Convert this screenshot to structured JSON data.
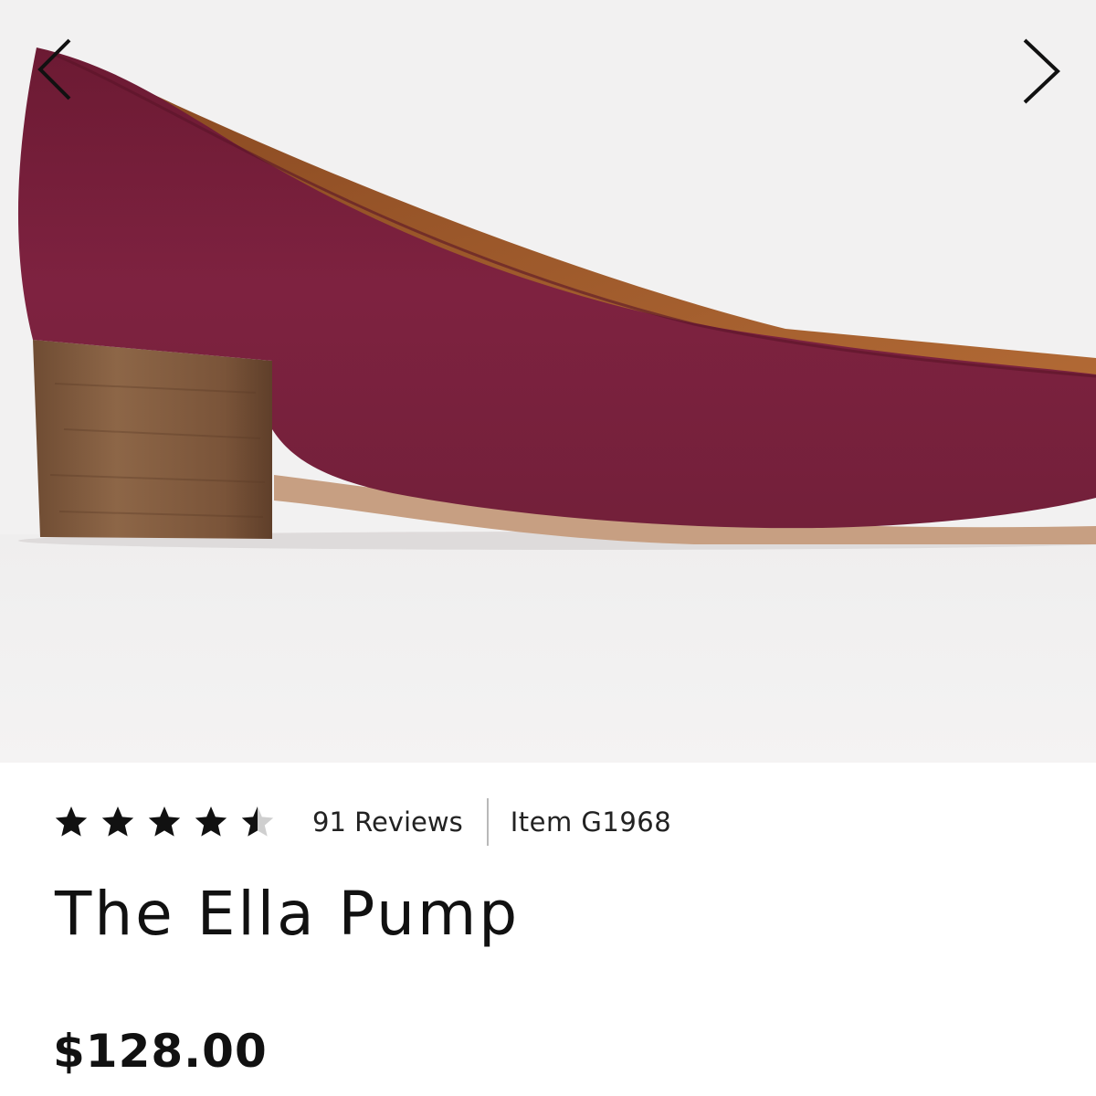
{
  "gallery": {
    "image_alt": "The Ella Pump",
    "prev_icon": "chevron-left-icon",
    "next_icon": "chevron-right-icon",
    "shoe_color": "#7e1f3a",
    "heel_color": "#8a6244"
  },
  "rating": {
    "value": 4.5,
    "max": 5,
    "reviews_label": "91 Reviews"
  },
  "product": {
    "item_label": "Item G1968",
    "title": "The Ella Pump",
    "price": "$128.00"
  }
}
